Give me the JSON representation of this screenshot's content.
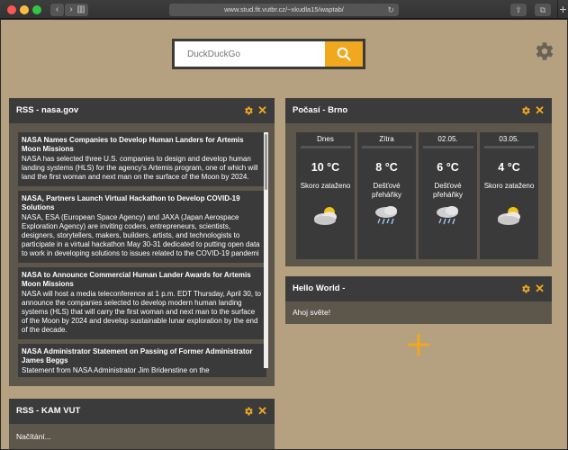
{
  "browser": {
    "url": "www.stud.fit.vutbr.cz/~xkudla15/waptab/",
    "back_glyph": "‹",
    "forward_glyph": "›",
    "sidebar_glyph": "▥",
    "reload_glyph": "↻",
    "share_glyph": "⇪",
    "tabs_glyph": "⧉",
    "newtab_glyph": "+"
  },
  "search": {
    "placeholder": "DuckDuckGo",
    "button_icon": "search-icon"
  },
  "colors": {
    "accent": "#f0a81e",
    "page_background": "#b5a07f",
    "widget_header": "#3b3b3b",
    "widget_body": "#5d564a"
  },
  "rss_nasa": {
    "title": "RSS - nasa.gov",
    "items": [
      {
        "title": "NASA Names Companies to Develop Human Landers for Artemis Moon Missions",
        "desc": "NASA has selected three U.S. companies to design and develop human landing systems (HLS) for the agency's Artemis program, one of which will land the first woman and next man on the surface of the Moon by 2024."
      },
      {
        "title": "NASA, Partners Launch Virtual Hackathon to Develop COVID-19 Solutions",
        "desc": "NASA, ESA (European Space Agency) and JAXA (Japan Aerospace Exploration Agency) are inviting coders, entrepreneurs, scientists, designers, storytellers, makers, builders, artists, and technologists to participate in a virtual hackathon May 30-31 dedicated to putting open data to work in developing solutions to issues related to the COVID-19 pandemi"
      },
      {
        "title": "NASA to Announce Commercial Human Lander Awards for Artemis Moon Missions",
        "desc": "NASA will host a media teleconference at 1 p.m. EDT Thursday, April 30, to announce the companies selected to develop modern human landing systems (HLS) that will carry the first woman and next man to the surface of the Moon by 2024 and develop sustainable lunar exploration by the end of the decade."
      },
      {
        "title": "NASA Administrator Statement on Passing of Former Administrator James Beggs",
        "desc": "Statement from NASA Administrator Jim Bridenstine on the"
      }
    ]
  },
  "weather": {
    "title": "Počasí - Brno",
    "days": [
      {
        "name": "Dnes",
        "temp": "10 °C",
        "desc": "Skoro zataženo",
        "icon": "partly-cloudy-icon"
      },
      {
        "name": "Zítra",
        "temp": "8 °C",
        "desc": "Dešťové přeháňky",
        "icon": "rain-showers-icon"
      },
      {
        "name": "02.05.",
        "temp": "6 °C",
        "desc": "Dešťové přeháňky",
        "icon": "rain-showers-icon"
      },
      {
        "name": "03.05.",
        "temp": "4 °C",
        "desc": "Skoro zataženo",
        "icon": "partly-cloudy-icon"
      }
    ]
  },
  "hello": {
    "title": "Hello World -",
    "content": "Ahoj světe!"
  },
  "rss_kam": {
    "title": "RSS - KAM VUT",
    "content": "Načítání..."
  }
}
